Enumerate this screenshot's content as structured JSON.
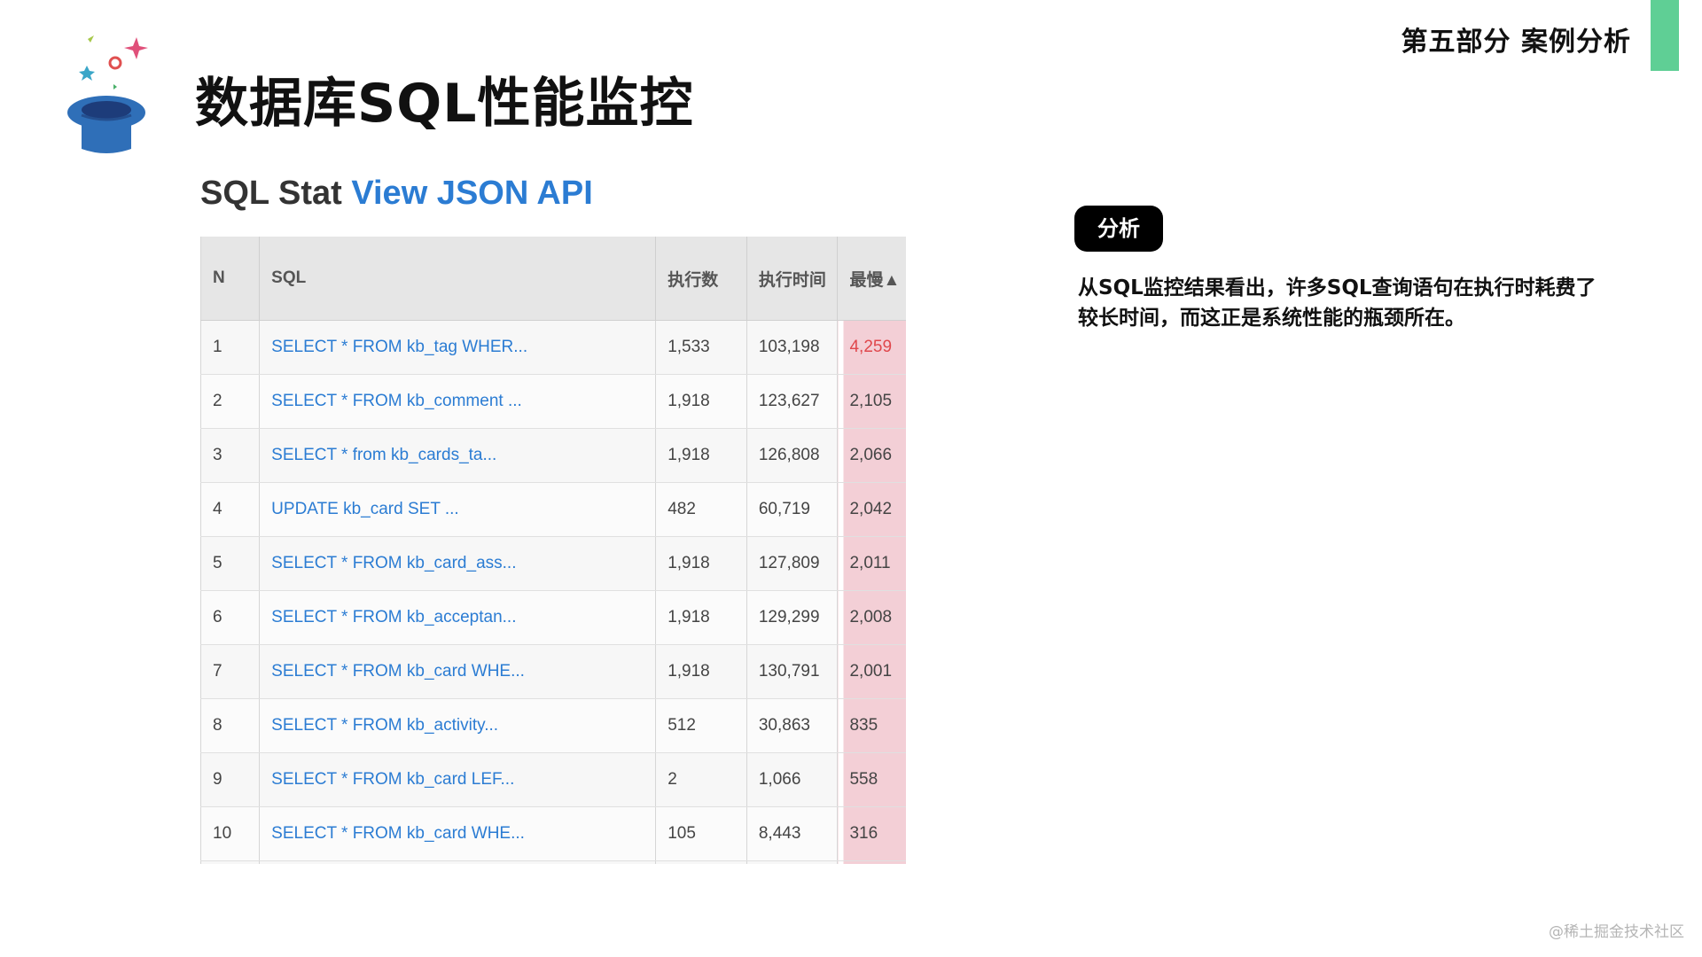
{
  "header": {
    "section_label": "第五部分 案例分析",
    "title": "数据库SQL性能监控"
  },
  "panel": {
    "heading_prefix": "SQL Stat ",
    "heading_link": "View JSON API",
    "columns": [
      "N",
      "SQL",
      "执行数",
      "执行时间",
      "最慢▲"
    ],
    "rows": [
      {
        "n": "1",
        "sql": "SELECT * FROM kb_tag WHER...",
        "count": "1,533",
        "time": "103,198",
        "slowest": "4,259"
      },
      {
        "n": "2",
        "sql": "SELECT * FROM kb_comment ...",
        "count": "1,918",
        "time": "123,627",
        "slowest": "2,105"
      },
      {
        "n": "3",
        "sql": "SELECT * from kb_cards_ta...",
        "count": "1,918",
        "time": "126,808",
        "slowest": "2,066"
      },
      {
        "n": "4",
        "sql": "UPDATE kb_card SET ...",
        "count": "482",
        "time": "60,719",
        "slowest": "2,042"
      },
      {
        "n": "5",
        "sql": "SELECT * FROM kb_card_ass...",
        "count": "1,918",
        "time": "127,809",
        "slowest": "2,011"
      },
      {
        "n": "6",
        "sql": "SELECT * FROM kb_acceptan...",
        "count": "1,918",
        "time": "129,299",
        "slowest": "2,008"
      },
      {
        "n": "7",
        "sql": "SELECT * FROM kb_card WHE...",
        "count": "1,918",
        "time": "130,791",
        "slowest": "2,001"
      },
      {
        "n": "8",
        "sql": "SELECT * FROM kb_activity...",
        "count": "512",
        "time": "30,863",
        "slowest": "835"
      },
      {
        "n": "9",
        "sql": "SELECT * FROM kb_card LEF...",
        "count": "2",
        "time": "1,066",
        "slowest": "558"
      },
      {
        "n": "10",
        "sql": "SELECT * FROM kb_card WHE...",
        "count": "105",
        "time": "8,443",
        "slowest": "316"
      }
    ]
  },
  "analysis": {
    "badge": "分析",
    "text": "从SQL监控结果看出，许多SQL查询语句在执行时耗费了较长时间，而这正是系统性能的瓶颈所在。"
  },
  "watermark": "@稀土掘金技术社区",
  "colors": {
    "accent_green": "#5fcf95",
    "link_blue": "#2b7cd3",
    "slow_highlight": "#f3cfd6",
    "slow_top_text": "#e0474c"
  }
}
